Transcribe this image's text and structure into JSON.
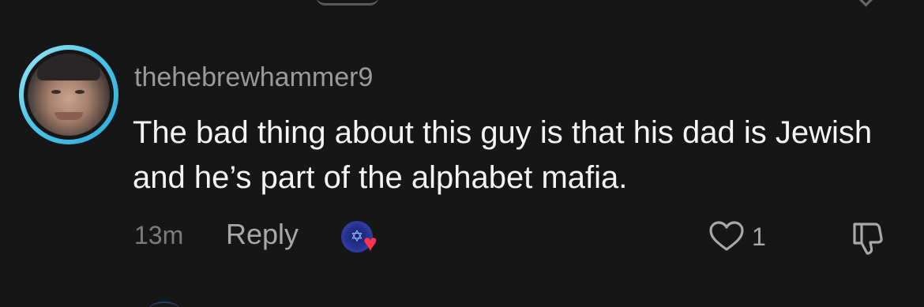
{
  "comment": {
    "username": "thehebrewhammer9",
    "text": "The bad thing about this guy is that his dad is Jewish and he’s part of the alphabet mafia.",
    "timestamp": "13m",
    "reply_label": "Reply",
    "like_count": "1",
    "avatar_ring_color": "#4cc6e8",
    "creator_reaction_heart_color": "#ff3550"
  },
  "icons": {
    "avatar": "user-photo",
    "creator_reaction": "creator-avatar-with-heart",
    "like": "heart-outline-icon",
    "dislike": "thumbs-down-icon"
  },
  "theme": {
    "background": "#161616",
    "username_color": "#9a9a9a",
    "text_color": "#f4f4f4",
    "meta_color": "#7c7c7c"
  }
}
